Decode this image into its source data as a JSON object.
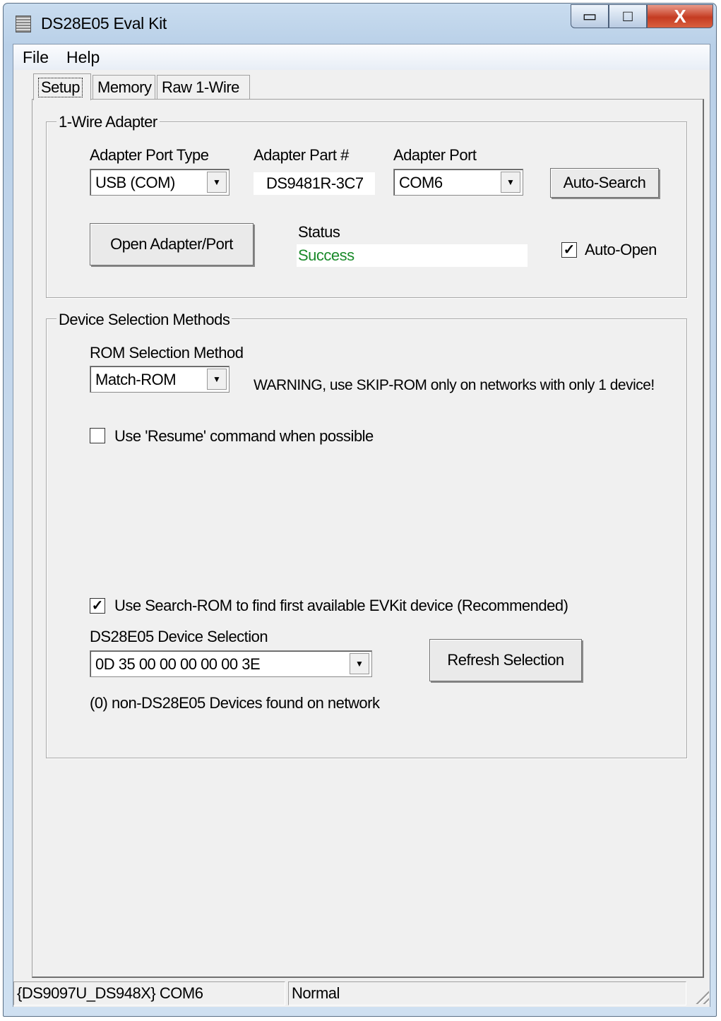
{
  "window": {
    "title": "DS28E05 Eval Kit",
    "caption_buttons": {
      "minimize": "▭",
      "maximize": "□",
      "close": "X"
    }
  },
  "menu": {
    "items": [
      "File",
      "Help"
    ]
  },
  "tabs": [
    {
      "label": "Setup",
      "active": true
    },
    {
      "label": "Memory",
      "active": false
    },
    {
      "label": "Raw 1-Wire",
      "active": false
    }
  ],
  "adapter_group": {
    "title": "1-Wire Adapter",
    "port_type_label": "Adapter Port Type",
    "port_type_value": "USB (COM)",
    "part_label": "Adapter Part #",
    "part_value": "DS9481R-3C7",
    "port_label": "Adapter Port",
    "port_value": "COM6",
    "auto_search_button": "Auto-Search",
    "open_button": "Open Adapter/Port",
    "status_label": "Status",
    "status_value": "Success",
    "status_color": "#1a8a2a",
    "auto_open_label": "Auto-Open",
    "auto_open_checked": true
  },
  "device_group": {
    "title": "Device Selection Methods",
    "rom_method_label": "ROM Selection Method",
    "rom_method_value": "Match-ROM",
    "warning": "WARNING, use SKIP-ROM only on networks with only 1 device!",
    "resume_label": "Use 'Resume' command when possible",
    "resume_checked": false,
    "search_rom_label": "Use Search-ROM to find first available EVKit device (Recommended)",
    "search_rom_checked": true,
    "device_selection_label": "DS28E05 Device Selection",
    "device_selection_value": "0D 35 00 00 00 00 00 3E",
    "refresh_button": "Refresh Selection",
    "non_device_note": "(0) non-DS28E05 Devices found on network"
  },
  "statusbar": {
    "left": "{DS9097U_DS948X} COM6",
    "right": "Normal"
  }
}
